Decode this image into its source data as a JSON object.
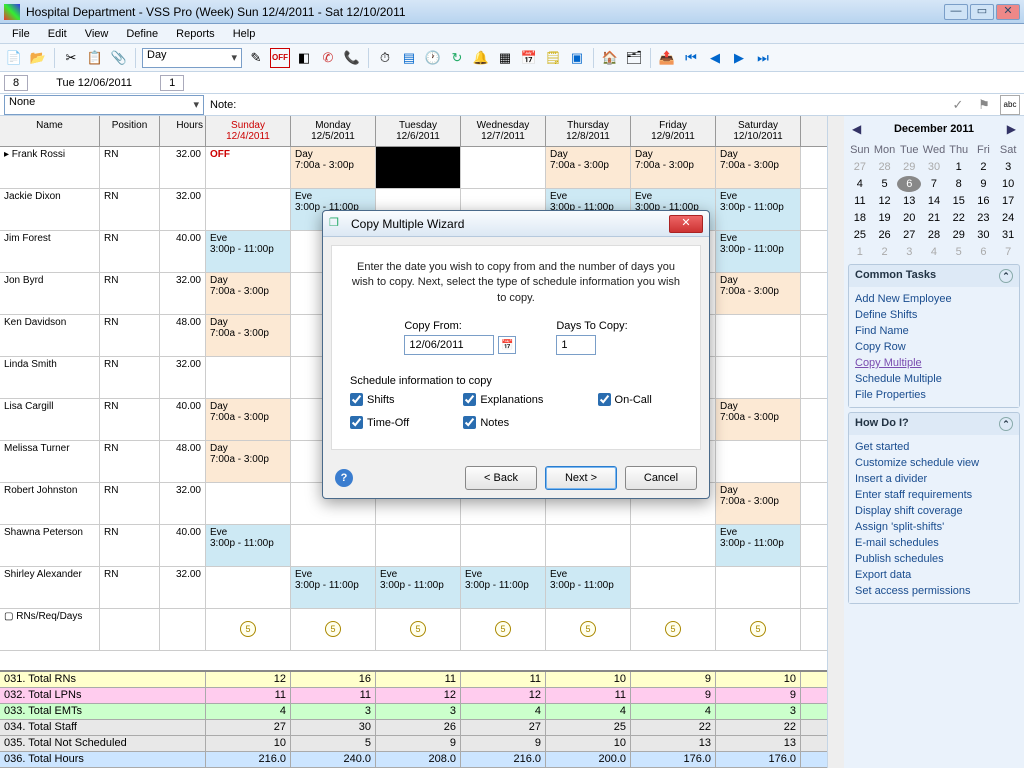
{
  "window": {
    "title": "Hospital Department - VSS Pro (Week) Sun 12/4/2011 - Sat 12/10/2011"
  },
  "menu": {
    "file": "File",
    "edit": "Edit",
    "view": "View",
    "define": "Define",
    "reports": "Reports",
    "help": "Help"
  },
  "toolbar": {
    "combo": "Day"
  },
  "subbar": {
    "box1": "8",
    "date": "Tue  12/06/2011",
    "box3": "1"
  },
  "note": {
    "label": "Note:",
    "combo": "None"
  },
  "headers": {
    "name": "Name",
    "position": "Position",
    "hours": "Hours",
    "d0": "Sunday\n12/4/2011",
    "d1": "Monday\n12/5/2011",
    "d2": "Tuesday\n12/6/2011",
    "d3": "Wednesday\n12/7/2011",
    "d4": "Thursday\n12/8/2011",
    "d5": "Friday\n12/9/2011",
    "d6": "Saturday\n12/10/2011"
  },
  "rows": [
    {
      "name": "Frank Rossi",
      "pos": "RN",
      "hrs": "32.00",
      "cells": [
        {
          "t": "OFF",
          "cls": "shift-off"
        },
        {
          "t": "Day\n7:00a - 3:00p",
          "cls": "shift-day"
        },
        {
          "t": "",
          "cls": "shift-black"
        },
        {
          "t": "",
          "cls": ""
        },
        {
          "t": "Day\n7:00a - 3:00p",
          "cls": "shift-day"
        },
        {
          "t": "Day\n7:00a - 3:00p",
          "cls": "shift-day"
        },
        {
          "t": "Day\n7:00a - 3:00p",
          "cls": "shift-day"
        }
      ]
    },
    {
      "name": "Jackie Dixon",
      "pos": "RN",
      "hrs": "32.00",
      "cells": [
        {
          "t": "",
          "cls": ""
        },
        {
          "t": "Eve\n3:00p - 11:00p",
          "cls": "shift-eve"
        },
        {
          "t": "",
          "cls": ""
        },
        {
          "t": "",
          "cls": ""
        },
        {
          "t": "Eve\n3:00p - 11:00p",
          "cls": "shift-eve"
        },
        {
          "t": "Eve\n3:00p - 11:00p",
          "cls": "shift-eve"
        },
        {
          "t": "Eve\n3:00p - 11:00p",
          "cls": "shift-eve"
        }
      ]
    },
    {
      "name": "Jim Forest",
      "pos": "RN",
      "hrs": "40.00",
      "cells": [
        {
          "t": "Eve\n3:00p - 11:00p",
          "cls": "shift-eve"
        },
        {
          "t": "",
          "cls": ""
        },
        {
          "t": "",
          "cls": ""
        },
        {
          "t": "",
          "cls": ""
        },
        {
          "t": "",
          "cls": ""
        },
        {
          "t": "",
          "cls": ""
        },
        {
          "t": "Eve\n3:00p - 11:00p",
          "cls": "shift-eve"
        }
      ]
    },
    {
      "name": "Jon Byrd",
      "pos": "RN",
      "hrs": "32.00",
      "cells": [
        {
          "t": "Day\n7:00a - 3:00p",
          "cls": "shift-day"
        },
        {
          "t": "",
          "cls": ""
        },
        {
          "t": "",
          "cls": ""
        },
        {
          "t": "",
          "cls": ""
        },
        {
          "t": "",
          "cls": ""
        },
        {
          "t": "",
          "cls": ""
        },
        {
          "t": "Day\n7:00a - 3:00p",
          "cls": "shift-day"
        }
      ]
    },
    {
      "name": "Ken Davidson",
      "pos": "RN",
      "hrs": "48.00",
      "cells": [
        {
          "t": "Day\n7:00a - 3:00p",
          "cls": "shift-day"
        },
        {
          "t": "",
          "cls": ""
        },
        {
          "t": "",
          "cls": ""
        },
        {
          "t": "",
          "cls": ""
        },
        {
          "t": "",
          "cls": ""
        },
        {
          "t": "",
          "cls": ""
        },
        {
          "t": "",
          "cls": ""
        }
      ]
    },
    {
      "name": "Linda Smith",
      "pos": "RN",
      "hrs": "32.00",
      "cells": [
        {
          "t": "",
          "cls": ""
        },
        {
          "t": "",
          "cls": ""
        },
        {
          "t": "",
          "cls": ""
        },
        {
          "t": "",
          "cls": ""
        },
        {
          "t": "",
          "cls": ""
        },
        {
          "t": "",
          "cls": ""
        },
        {
          "t": "",
          "cls": ""
        }
      ]
    },
    {
      "name": "Lisa Cargill",
      "pos": "RN",
      "hrs": "40.00",
      "cells": [
        {
          "t": "Day\n7:00a - 3:00p",
          "cls": "shift-day"
        },
        {
          "t": "",
          "cls": ""
        },
        {
          "t": "",
          "cls": ""
        },
        {
          "t": "",
          "cls": ""
        },
        {
          "t": "",
          "cls": ""
        },
        {
          "t": "",
          "cls": ""
        },
        {
          "t": "Day\n7:00a - 3:00p",
          "cls": "shift-day"
        }
      ]
    },
    {
      "name": "Melissa Turner",
      "pos": "RN",
      "hrs": "48.00",
      "cells": [
        {
          "t": "Day\n7:00a - 3:00p",
          "cls": "shift-day"
        },
        {
          "t": "",
          "cls": ""
        },
        {
          "t": "",
          "cls": ""
        },
        {
          "t": "",
          "cls": ""
        },
        {
          "t": "",
          "cls": ""
        },
        {
          "t": "",
          "cls": ""
        },
        {
          "t": "",
          "cls": ""
        }
      ]
    },
    {
      "name": "Robert Johnston",
      "pos": "RN",
      "hrs": "32.00",
      "cells": [
        {
          "t": "",
          "cls": ""
        },
        {
          "t": "",
          "cls": ""
        },
        {
          "t": "",
          "cls": ""
        },
        {
          "t": "",
          "cls": ""
        },
        {
          "t": "",
          "cls": ""
        },
        {
          "t": "",
          "cls": ""
        },
        {
          "t": "Day\n7:00a - 3:00p",
          "cls": "shift-day"
        }
      ]
    },
    {
      "name": "Shawna Peterson",
      "pos": "RN",
      "hrs": "40.00",
      "cells": [
        {
          "t": "Eve\n3:00p - 11:00p",
          "cls": "shift-eve"
        },
        {
          "t": "",
          "cls": ""
        },
        {
          "t": "",
          "cls": ""
        },
        {
          "t": "",
          "cls": ""
        },
        {
          "t": "",
          "cls": ""
        },
        {
          "t": "",
          "cls": ""
        },
        {
          "t": "Eve\n3:00p - 11:00p",
          "cls": "shift-eve"
        }
      ]
    },
    {
      "name": "Shirley Alexander",
      "pos": "RN",
      "hrs": "32.00",
      "cells": [
        {
          "t": "",
          "cls": ""
        },
        {
          "t": "Eve\n3:00p - 11:00p",
          "cls": "shift-eve"
        },
        {
          "t": "Eve\n3:00p - 11:00p",
          "cls": "shift-eve"
        },
        {
          "t": "Eve\n3:00p - 11:00p",
          "cls": "shift-eve"
        },
        {
          "t": "Eve\n3:00p - 11:00p",
          "cls": "shift-eve"
        },
        {
          "t": "",
          "cls": ""
        },
        {
          "t": "",
          "cls": ""
        }
      ]
    }
  ],
  "reqRow": {
    "label": "RNs/Req/Days"
  },
  "totals": [
    {
      "label": "031. Total RNs",
      "cls": "tot-yellow",
      "vals": [
        "12",
        "16",
        "11",
        "11",
        "10",
        "9",
        "10"
      ]
    },
    {
      "label": "032. Total LPNs",
      "cls": "tot-pink",
      "vals": [
        "11",
        "11",
        "12",
        "12",
        "11",
        "9",
        "9"
      ]
    },
    {
      "label": "033. Total EMTs",
      "cls": "tot-green",
      "vals": [
        "4",
        "3",
        "3",
        "4",
        "4",
        "4",
        "3"
      ]
    },
    {
      "label": "034. Total Staff",
      "cls": "tot-gray",
      "vals": [
        "27",
        "30",
        "26",
        "27",
        "25",
        "22",
        "22"
      ]
    },
    {
      "label": "035. Total  Not Scheduled",
      "cls": "tot-gray",
      "vals": [
        "10",
        "5",
        "9",
        "9",
        "10",
        "13",
        "13"
      ]
    },
    {
      "label": "036. Total Hours",
      "cls": "tot-blue",
      "vals": [
        "216.0",
        "240.0",
        "208.0",
        "216.0",
        "200.0",
        "176.0",
        "176.0"
      ]
    }
  ],
  "calendar": {
    "title": "December 2011",
    "dow": [
      "Sun",
      "Mon",
      "Tue",
      "Wed",
      "Thu",
      "Fri",
      "Sat"
    ],
    "days": [
      {
        "n": "27",
        "g": true
      },
      {
        "n": "28",
        "g": true
      },
      {
        "n": "29",
        "g": true
      },
      {
        "n": "30",
        "g": true
      },
      {
        "n": "1"
      },
      {
        "n": "2"
      },
      {
        "n": "3"
      },
      {
        "n": "4"
      },
      {
        "n": "5"
      },
      {
        "n": "6",
        "sel": true
      },
      {
        "n": "7"
      },
      {
        "n": "8"
      },
      {
        "n": "9"
      },
      {
        "n": "10"
      },
      {
        "n": "11"
      },
      {
        "n": "12"
      },
      {
        "n": "13"
      },
      {
        "n": "14"
      },
      {
        "n": "15"
      },
      {
        "n": "16"
      },
      {
        "n": "17"
      },
      {
        "n": "18"
      },
      {
        "n": "19"
      },
      {
        "n": "20"
      },
      {
        "n": "21"
      },
      {
        "n": "22"
      },
      {
        "n": "23"
      },
      {
        "n": "24"
      },
      {
        "n": "25"
      },
      {
        "n": "26"
      },
      {
        "n": "27"
      },
      {
        "n": "28"
      },
      {
        "n": "29"
      },
      {
        "n": "30"
      },
      {
        "n": "31"
      },
      {
        "n": "1",
        "g": true
      },
      {
        "n": "2",
        "g": true
      },
      {
        "n": "3",
        "g": true
      },
      {
        "n": "4",
        "g": true
      },
      {
        "n": "5",
        "g": true
      },
      {
        "n": "6",
        "g": true
      },
      {
        "n": "7",
        "g": true
      }
    ]
  },
  "commonTasks": {
    "title": "Common Tasks",
    "items": [
      "Add New Employee",
      "Define Shifts",
      "Find Name",
      "Copy Row",
      "Copy Multiple",
      "Schedule Multiple",
      "File Properties"
    ],
    "activeIndex": 4
  },
  "howDoI": {
    "title": "How Do I?",
    "items": [
      "Get started",
      "Customize schedule view",
      "Insert a divider",
      "Enter staff requirements",
      "Display shift coverage",
      "Assign 'split-shifts'",
      "E-mail schedules",
      "Publish schedules",
      "Export data",
      "Set access permissions"
    ]
  },
  "dialog": {
    "title": "Copy Multiple Wizard",
    "instr": "Enter the date you wish to copy from and the number of days you wish to copy. Next, select the type of schedule information you wish to copy.",
    "copyFromLabel": "Copy From:",
    "copyFromValue": "12/06/2011",
    "daysLabel": "Days To Copy:",
    "daysValue": "1",
    "groupTitle": "Schedule information to copy",
    "checks": {
      "shifts": "Shifts",
      "explanations": "Explanations",
      "oncall": "On-Call",
      "timeoff": "Time-Off",
      "notes": "Notes"
    },
    "back": "< Back",
    "next": "Next >",
    "cancel": "Cancel"
  }
}
